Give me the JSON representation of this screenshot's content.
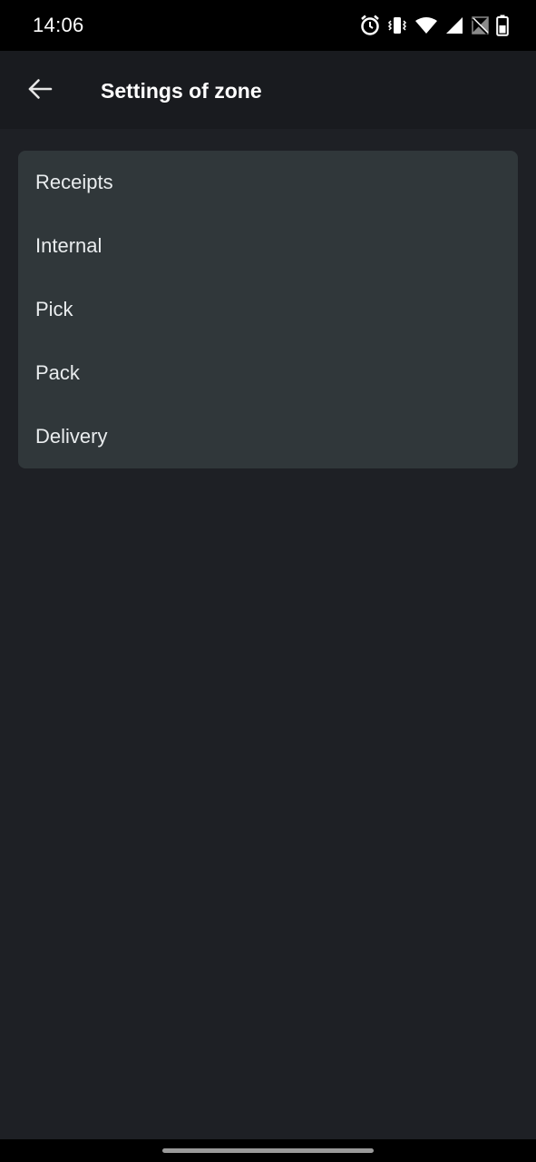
{
  "status_bar": {
    "time": "14:06",
    "icons": [
      "alarm-icon",
      "vibrate-icon",
      "wifi-icon",
      "cell-signal-icon",
      "no-sim-icon",
      "battery-icon"
    ]
  },
  "app_bar": {
    "back_icon": "arrow-left-icon",
    "title": "Settings of zone"
  },
  "zones": {
    "items": [
      {
        "label": "Receipts"
      },
      {
        "label": "Internal"
      },
      {
        "label": "Pick"
      },
      {
        "label": "Pack"
      },
      {
        "label": "Delivery"
      }
    ]
  },
  "colors": {
    "background": "#1e2025",
    "app_bar": "#191b1f",
    "card": "#30373a",
    "text": "#e9ecee"
  }
}
